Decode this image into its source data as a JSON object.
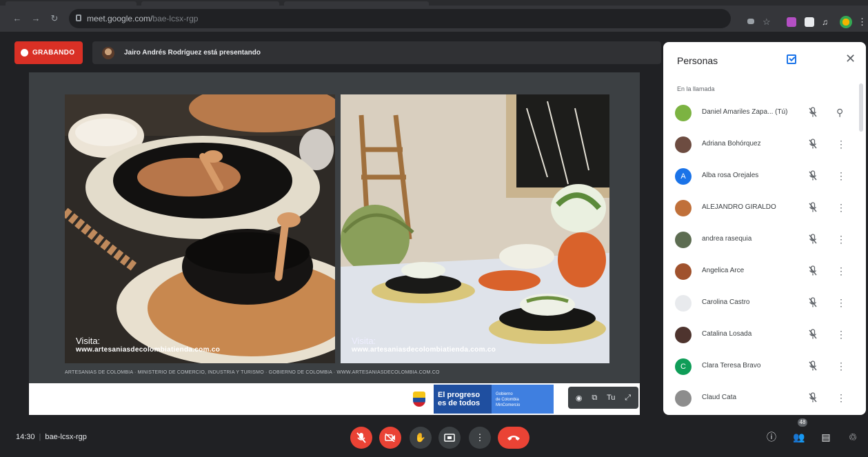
{
  "browser": {
    "url_host": "meet.google.com/",
    "url_path": "bae-lcsx-rgp"
  },
  "meeting": {
    "recording_label": "GRABANDO",
    "presenting_text": "Jairo Andrés Rodríguez está presentando",
    "time": "14:30",
    "code": "bae-lcsx-rgp"
  },
  "slide": {
    "visit_label_1": "Visita:",
    "visit_url_1": "www.artesaniasdecolombiatienda.com.co",
    "visit_label_2": "Visita:",
    "visit_url_2": "www.artesaniasdecolombiatienda.com.co",
    "footer_caption": "ARTESANÍAS DE COLOMBIA   ·   MINISTERIO DE COMERCIO, INDUSTRIA Y TURISMO   ·   GOBIERNO DE COLOMBIA   ·   WWW.ARTESANIASDECOLOMBIA.COM.CO"
  },
  "gov_banner": {
    "line1": "El progreso",
    "line2": "es de todos",
    "sub1": "Gobierno",
    "sub2": "de Colombia",
    "sub3": "MinComercio"
  },
  "present_controls": {
    "btn": "Tu"
  },
  "panel": {
    "title": "Personas",
    "section": "En la llamada",
    "participants": [
      {
        "name": "Daniel Amariles Zapa...  (Tú)",
        "initial": "",
        "color": "#7cb342",
        "action": "pin-icon"
      },
      {
        "name": "Adriana Bohórquez",
        "initial": "",
        "color": "#6d4c41",
        "action": "more-icon"
      },
      {
        "name": "Alba rosa Orejales",
        "initial": "A",
        "color": "#1a73e8",
        "action": "more-icon"
      },
      {
        "name": "ALEJANDRO GIRALDO",
        "initial": "",
        "color": "#c0703a",
        "action": "more-icon"
      },
      {
        "name": "andrea rasequia",
        "initial": "",
        "color": "#5d6d52",
        "action": "more-icon"
      },
      {
        "name": "Angelica Arce",
        "initial": "",
        "color": "#a0522d",
        "action": "more-icon"
      },
      {
        "name": "Carolina Castro",
        "initial": "",
        "color": "#e8eaed",
        "action": "more-icon"
      },
      {
        "name": "Catalina Losada",
        "initial": "",
        "color": "#4e342e",
        "action": "more-icon"
      },
      {
        "name": "Clara Teresa Bravo",
        "initial": "C",
        "color": "#0f9d58",
        "action": "more-icon"
      },
      {
        "name": "Claud Cata",
        "initial": "",
        "color": "#8d8d8d",
        "action": "more-icon"
      }
    ]
  },
  "bottom": {
    "people_count": "48"
  },
  "colors": {
    "accent": "#1a73e8",
    "danger": "#ea4335",
    "recording": "#d93025"
  }
}
